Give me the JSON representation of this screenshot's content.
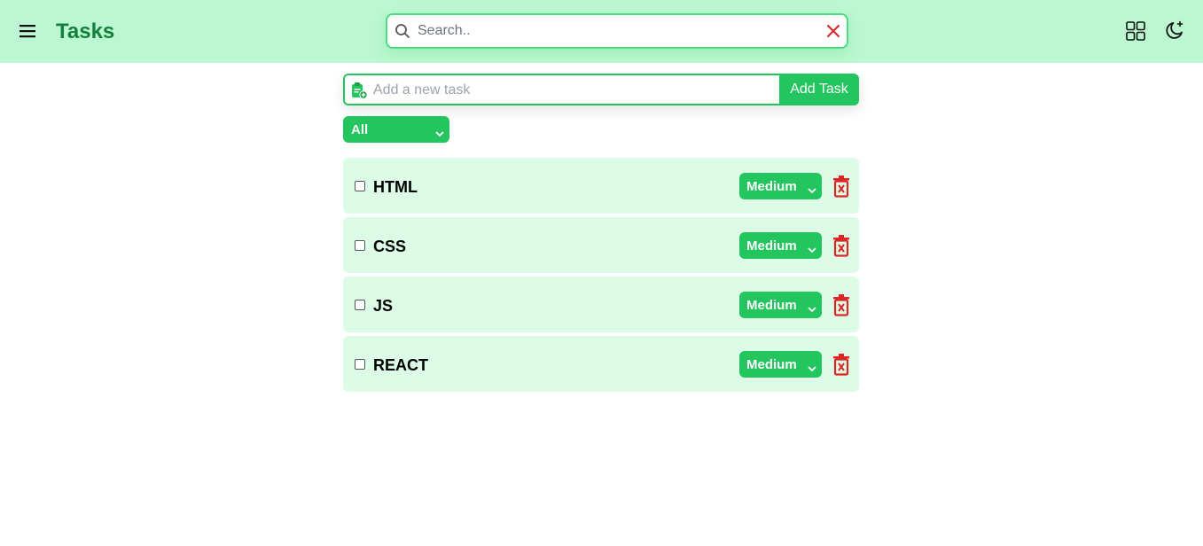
{
  "header": {
    "title": "Tasks",
    "menu_icon": "hamburger-menu-icon",
    "search": {
      "placeholder": "Search..",
      "value": "",
      "search_icon": "search-icon",
      "clear_icon": "close-icon"
    },
    "grid_icon": "grid-view-icon",
    "theme_icon": "moon-icon"
  },
  "add_task": {
    "placeholder": "Add a new task",
    "value": "",
    "icon": "clipboard-add-icon",
    "button_label": "Add Task"
  },
  "filter": {
    "selected": "All"
  },
  "tasks": [
    {
      "name": "HTML",
      "priority": "Medium",
      "checked": false
    },
    {
      "name": "CSS",
      "priority": "Medium",
      "checked": false
    },
    {
      "name": "JS",
      "priority": "Medium",
      "checked": false
    },
    {
      "name": "REACT",
      "priority": "Medium",
      "checked": false
    }
  ],
  "colors": {
    "header_bg": "#bbf7d0",
    "accent": "#22c55e",
    "title": "#15803d",
    "task_bg": "#dcfce7",
    "delete": "#dc2626"
  }
}
